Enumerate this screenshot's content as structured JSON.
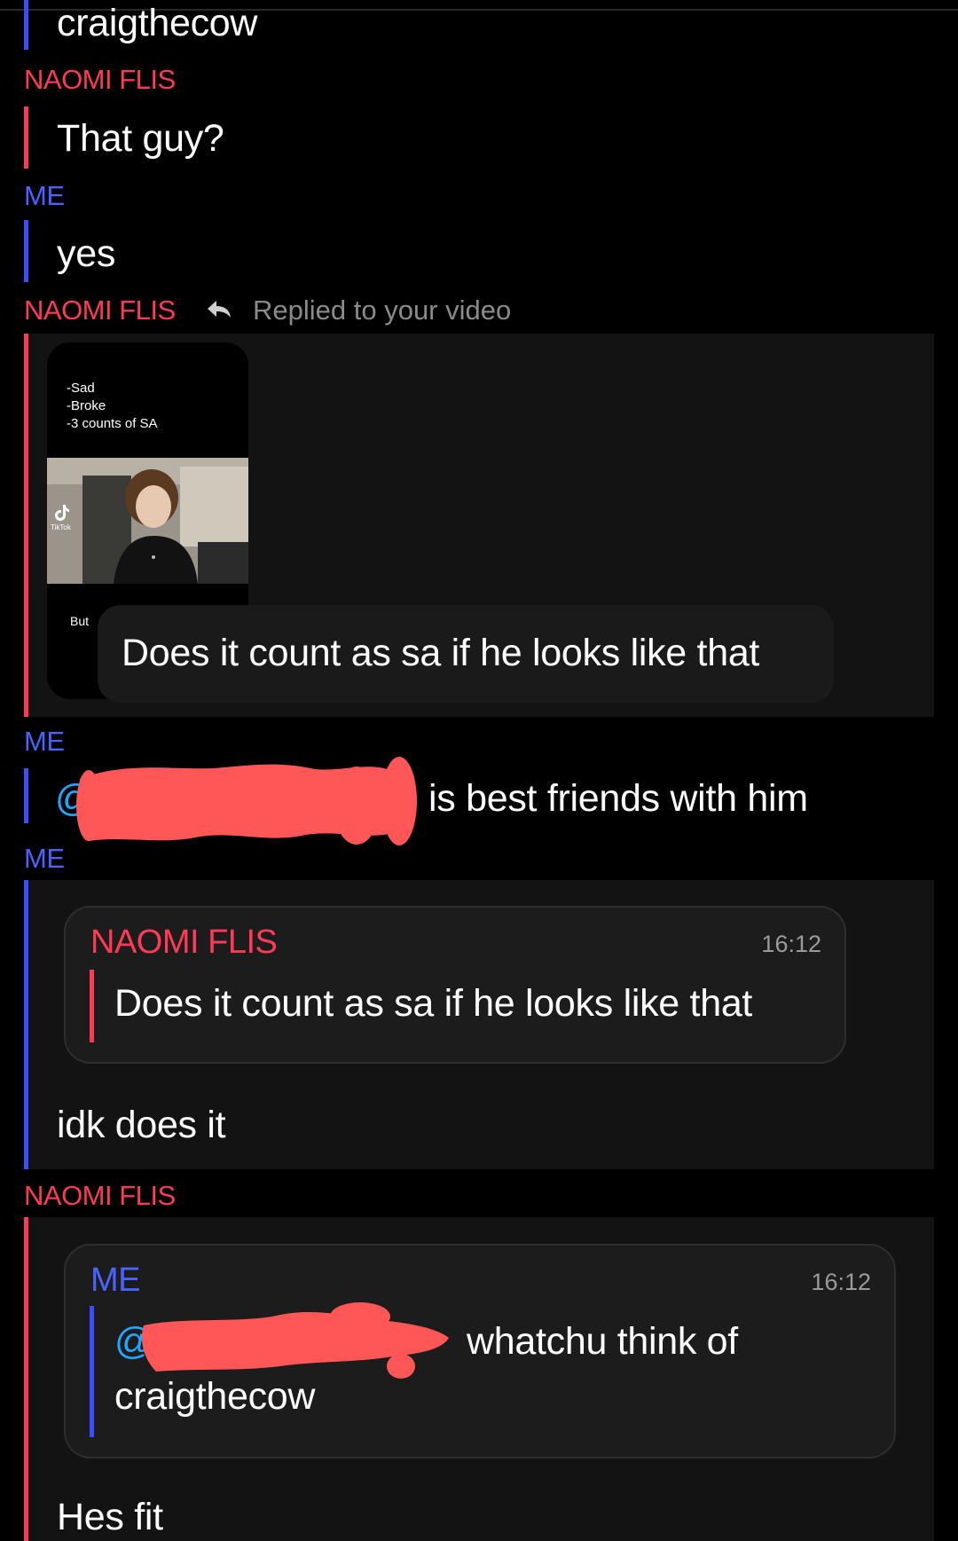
{
  "colors": {
    "naomi": "#ff3a57",
    "me": "#4a63ff",
    "mention": "#1ea7ff",
    "redaction": "#ff5757"
  },
  "messages": {
    "m0_text": "craigthecow",
    "m1_sender": "NAOMI FLIS",
    "m1_text": "That guy?",
    "m2_sender": "ME",
    "m2_text": "yes",
    "m3_sender": "NAOMI FLIS",
    "m3_replied": "Replied to your video",
    "m3_video_lines": [
      "-Sad",
      "-Broke",
      "-3 counts of SA"
    ],
    "m3_video_logo": "TikTok",
    "m3_video_footer": "But",
    "m3_text": "Does it count as sa if he looks like that",
    "m4_sender": "ME",
    "m4_mention": "@",
    "m4_text": "is best friends with him",
    "m5_sender": "ME",
    "m5_quote_sender": "NAOMI FLIS",
    "m5_quote_time": "16:12",
    "m5_quote_text": "Does it count as sa if he looks like that",
    "m5_text": "idk does it",
    "m6_sender": "NAOMI FLIS",
    "m6_quote_sender": "ME",
    "m6_quote_time": "16:12",
    "m6_quote_mention": "@",
    "m6_quote_text1": "whatchu think of",
    "m6_quote_text2": "craigthecow",
    "m6_text": "Hes fit"
  },
  "icons": {
    "reply": "reply-arrow-icon",
    "tiktok": "tiktok-logo-icon"
  }
}
